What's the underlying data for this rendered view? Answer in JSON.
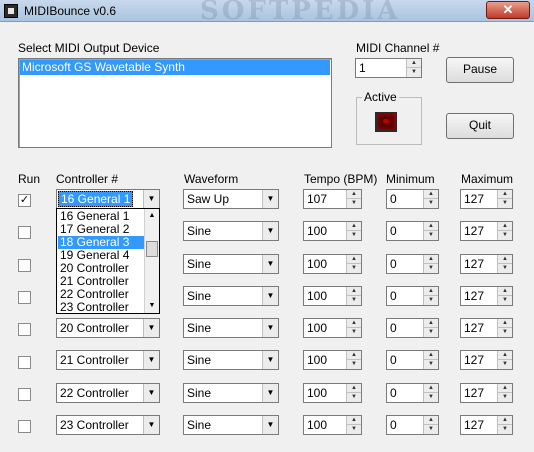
{
  "window": {
    "title": "MIDIBounce v0.6",
    "watermark": "SOFTPEDIA",
    "watermark_url": "www.softpedia.com",
    "close_glyph": "✕"
  },
  "device": {
    "label": "Select MIDI Output Device",
    "selected": "Microsoft GS Wavetable Synth"
  },
  "channel": {
    "label": "MIDI Channel #",
    "value": "1"
  },
  "buttons": {
    "pause": "Pause",
    "quit": "Quit"
  },
  "active": {
    "label": "Active"
  },
  "headers": {
    "run": "Run",
    "controller": "Controller #",
    "waveform": "Waveform",
    "tempo": "Tempo (BPM)",
    "minimum": "Minimum",
    "maximum": "Maximum"
  },
  "rows": [
    {
      "checked": "✓",
      "controller": "16 General 1",
      "waveform": "Saw Up",
      "tempo": "107",
      "min": "0",
      "max": "127"
    },
    {
      "checked": "",
      "controller": "",
      "waveform": "Sine",
      "tempo": "100",
      "min": "0",
      "max": "127"
    },
    {
      "checked": "",
      "controller": "",
      "waveform": "Sine",
      "tempo": "100",
      "min": "0",
      "max": "127"
    },
    {
      "checked": "",
      "controller": "",
      "waveform": "Sine",
      "tempo": "100",
      "min": "0",
      "max": "127"
    },
    {
      "checked": "",
      "controller": "20 Controller",
      "waveform": "Sine",
      "tempo": "100",
      "min": "0",
      "max": "127"
    },
    {
      "checked": "",
      "controller": "21 Controller",
      "waveform": "Sine",
      "tempo": "100",
      "min": "0",
      "max": "127"
    },
    {
      "checked": "",
      "controller": "22 Controller",
      "waveform": "Sine",
      "tempo": "100",
      "min": "0",
      "max": "127"
    },
    {
      "checked": "",
      "controller": "23 Controller",
      "waveform": "Sine",
      "tempo": "100",
      "min": "0",
      "max": "127"
    }
  ],
  "dropdown": {
    "items": [
      "16 General 1",
      "17 General 2",
      "18 General 3",
      "19 General 4",
      "20 Controller",
      "21 Controller",
      "22 Controller",
      "23 Controller"
    ],
    "selected_index": 2
  },
  "colors": {
    "selection": "#3399ff",
    "led": "#5a0000",
    "close": "#c0392b"
  }
}
